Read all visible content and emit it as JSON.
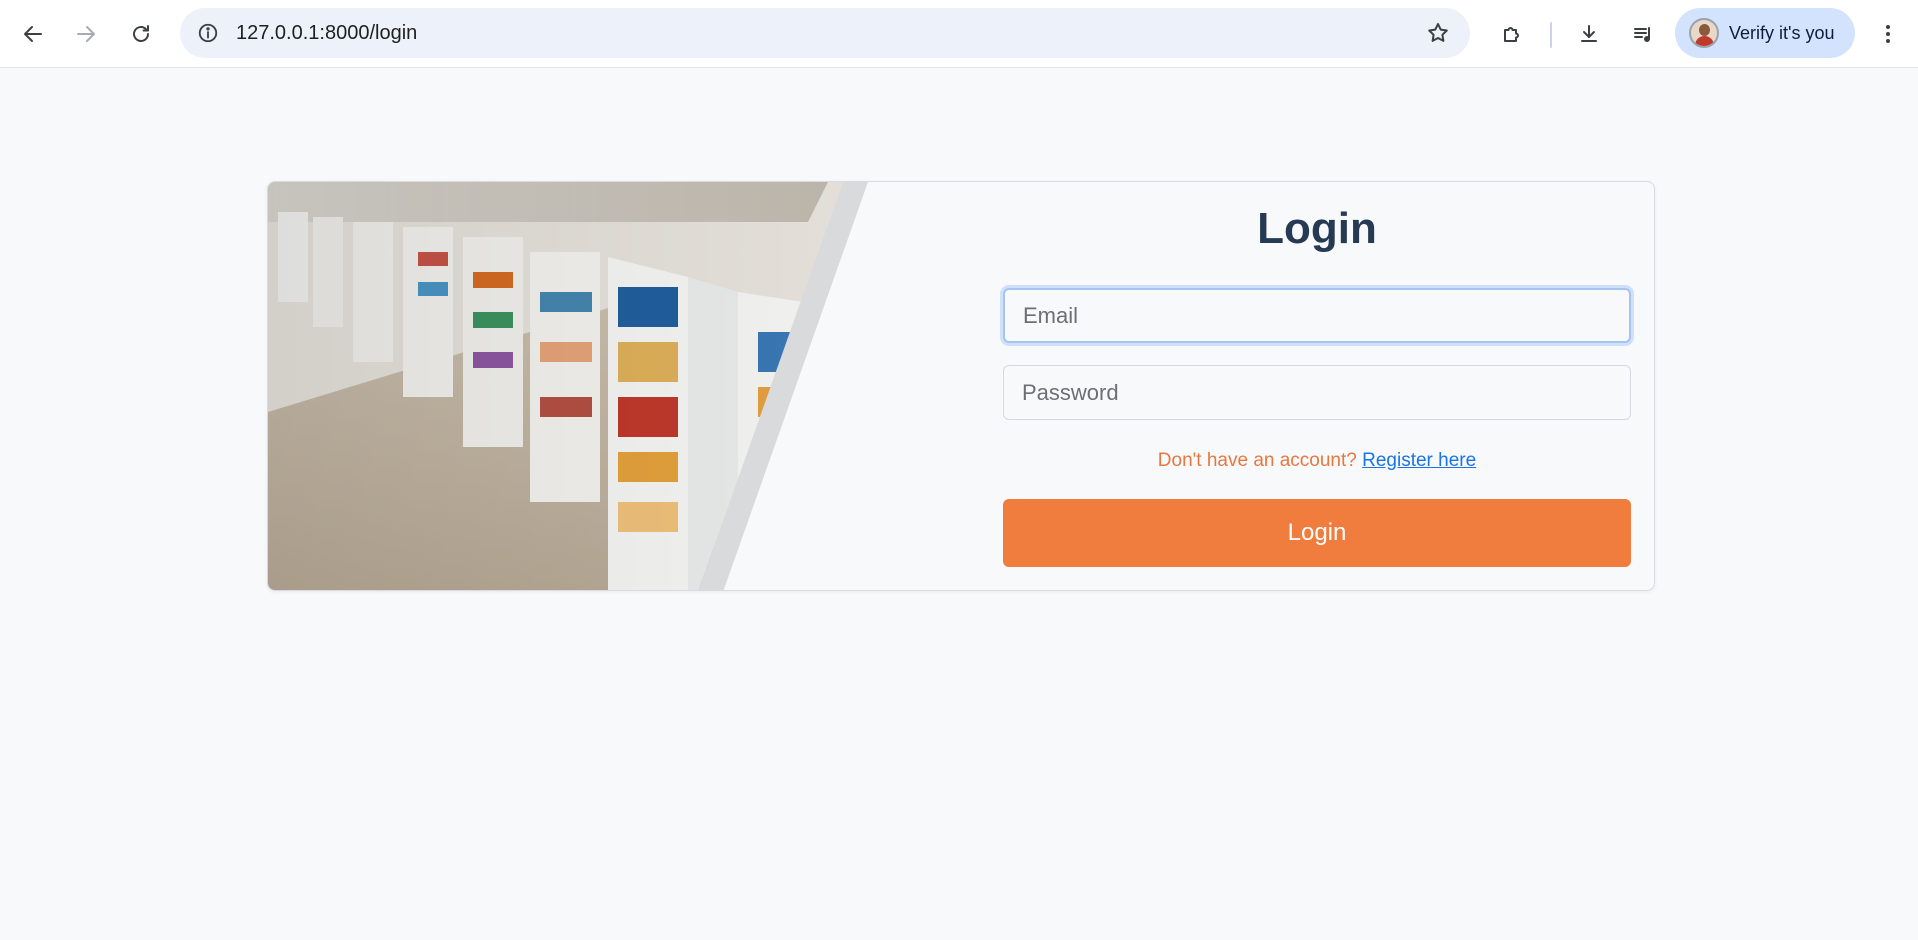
{
  "browser": {
    "url": "127.0.0.1:8000/login",
    "profile_label": "Verify it's you",
    "icons": [
      "back-arrow-icon",
      "forward-arrow-icon",
      "reload-icon",
      "site-info-icon",
      "bookmark-star-icon",
      "extensions-icon",
      "download-icon",
      "media-queue-icon",
      "profile-avatar-icon",
      "more-menu-icon"
    ]
  },
  "login": {
    "title": "Login",
    "email_placeholder": "Email",
    "password_placeholder": "Password",
    "register_prompt": "Don't have an account?",
    "register_link": "Register here",
    "submit_label": "Login",
    "accent_color": "#f07c3e",
    "title_color": "#273a53"
  }
}
